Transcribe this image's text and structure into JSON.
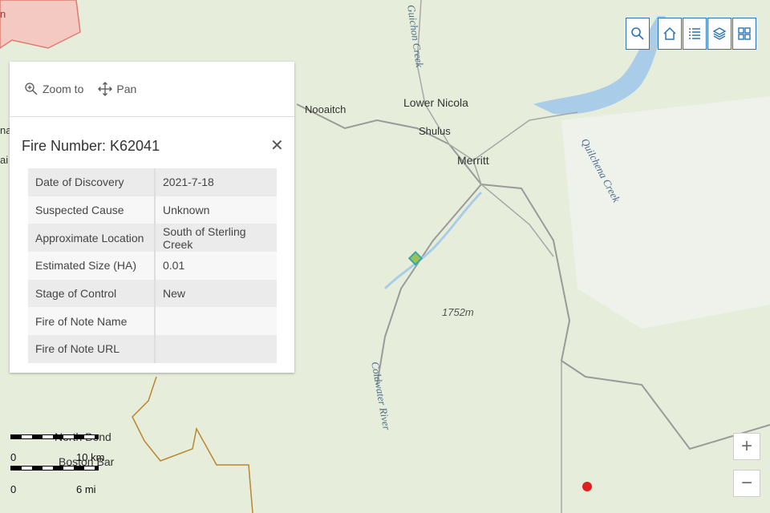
{
  "map": {
    "place_labels": [
      "Lower Nicola",
      "Shulus",
      "Merritt",
      "Nooaitch",
      "North Bend",
      "Boston Bar"
    ],
    "water_labels": [
      "Quilchena Creek",
      "Coldwater River",
      "Guichon Creek"
    ],
    "elevation_label": "1752m",
    "edge_labels": [
      "n",
      "na",
      "ai"
    ]
  },
  "toolbar": {
    "items": [
      {
        "icon": "search-icon"
      },
      {
        "icon": "home-icon"
      },
      {
        "icon": "legend-list-icon"
      },
      {
        "icon": "layers-icon"
      },
      {
        "icon": "basemap-gallery-icon"
      }
    ]
  },
  "zoom": {
    "in": "+",
    "out": "−"
  },
  "popup": {
    "zoom_to": "Zoom to",
    "pan": "Pan",
    "title": "Fire Number: K62041",
    "close": "✕",
    "rows": [
      {
        "key": "Date of Discovery",
        "value": "2021-7-18"
      },
      {
        "key": "Suspected Cause",
        "value": "Unknown"
      },
      {
        "key": "Approximate Location",
        "value": "South of Sterling Creek"
      },
      {
        "key": "Estimated Size (HA)",
        "value": "0.01"
      },
      {
        "key": "Stage of Control",
        "value": "New"
      },
      {
        "key": "Fire of Note Name",
        "value": ""
      },
      {
        "key": "Fire of Note URL",
        "value": ""
      }
    ]
  },
  "scale": {
    "km_zero": "0",
    "km_label": "10 km",
    "mi_zero": "0",
    "mi_label": "6 mi"
  },
  "colors": {
    "fire_marker": "#e02020",
    "selected_marker": "#3aa7a0",
    "fire_perimeter": "#b8862e",
    "lake": "#a9cde8"
  }
}
